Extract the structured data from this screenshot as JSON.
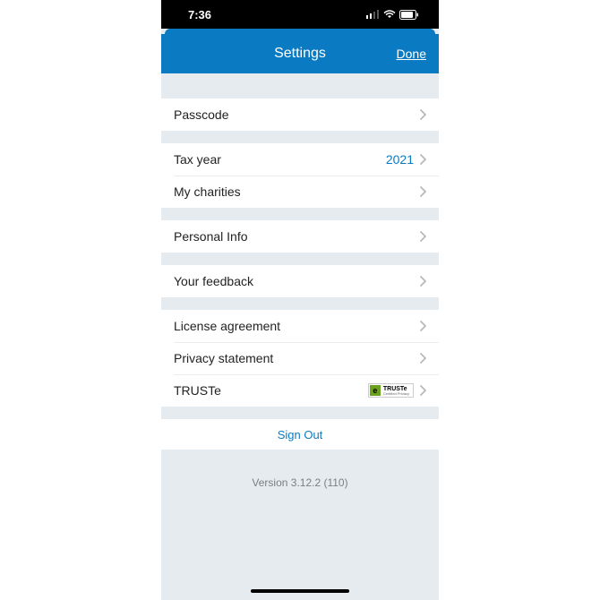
{
  "statusbar": {
    "time": "7:36"
  },
  "header": {
    "title": "Settings",
    "done": "Done"
  },
  "rows": {
    "passcode": "Passcode",
    "tax_year": "Tax year",
    "tax_year_value": "2021",
    "my_charities": "My charities",
    "personal_info": "Personal Info",
    "feedback": "Your feedback",
    "license": "License agreement",
    "privacy": "Privacy statement",
    "truste": "TRUSTe"
  },
  "truste_badge": {
    "brand": "TRUSTe",
    "sub": "Certified Privacy"
  },
  "signout": "Sign Out",
  "version": "Version 3.12.2 (110)"
}
